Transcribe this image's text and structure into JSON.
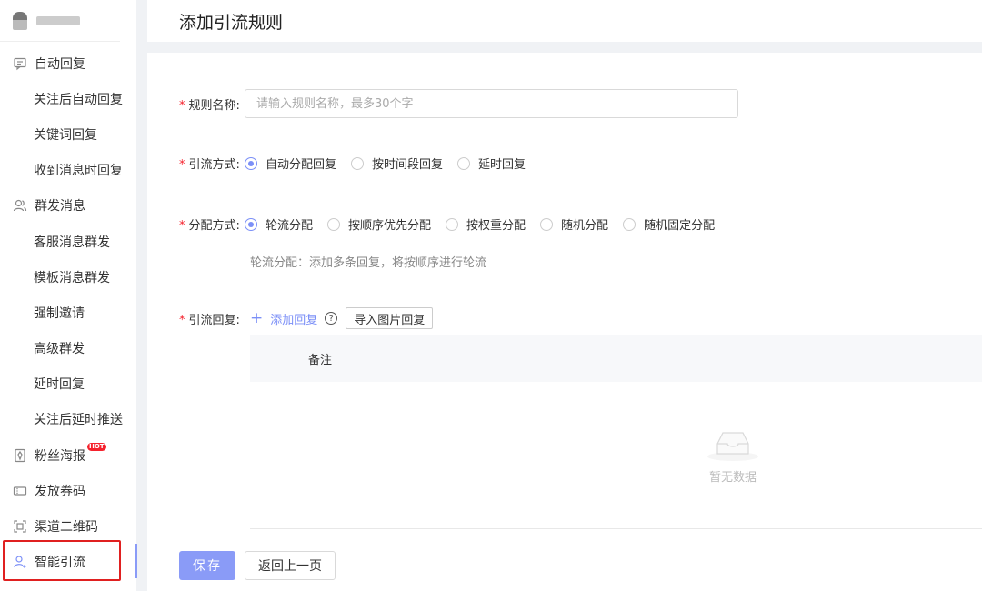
{
  "sidebar": {
    "items": [
      {
        "label": "自动回复",
        "icon": "message-icon",
        "type": "group"
      },
      {
        "label": "关注后自动回复",
        "type": "sub"
      },
      {
        "label": "关键词回复",
        "type": "sub"
      },
      {
        "label": "收到消息时回复",
        "type": "sub"
      },
      {
        "label": "群发消息",
        "icon": "users-icon",
        "type": "group"
      },
      {
        "label": "客服消息群发",
        "type": "sub"
      },
      {
        "label": "模板消息群发",
        "type": "sub"
      },
      {
        "label": "强制邀请",
        "type": "sub"
      },
      {
        "label": "高级群发",
        "type": "sub"
      },
      {
        "label": "延时回复",
        "type": "sub"
      },
      {
        "label": "关注后延时推送",
        "type": "sub"
      },
      {
        "label": "粉丝海报",
        "icon": "poster-icon",
        "type": "group",
        "badge": "HOT"
      },
      {
        "label": "发放券码",
        "icon": "coupon-icon",
        "type": "group"
      },
      {
        "label": "渠道二维码",
        "icon": "qrcode-icon",
        "type": "group"
      },
      {
        "label": "智能引流",
        "icon": "user-flow-icon",
        "type": "group",
        "active": true
      }
    ]
  },
  "header": {
    "title": "添加引流规则"
  },
  "form": {
    "rule_name": {
      "label": "规则名称:",
      "placeholder": "请输入规则名称，最多30个字",
      "value": ""
    },
    "traffic_mode": {
      "label": "引流方式:",
      "options": [
        "自动分配回复",
        "按时间段回复",
        "延时回复"
      ],
      "selected": "自动分配回复"
    },
    "distribution": {
      "label": "分配方式:",
      "options": [
        "轮流分配",
        "按顺序优先分配",
        "按权重分配",
        "随机分配",
        "随机固定分配"
      ],
      "selected": "轮流分配",
      "hint": "轮流分配：添加多条回复，将按顺序进行轮流"
    },
    "replies": {
      "label": "引流回复:",
      "add_label": "添加回复",
      "import_label": "导入图片回复",
      "table_header": "备注",
      "empty_text": "暂无数据"
    }
  },
  "actions": {
    "save_label": "保存",
    "back_label": "返回上一页"
  },
  "colors": {
    "accent": "#7b8ff7",
    "required": "#f5222d",
    "highlight_box": "#e02020"
  }
}
